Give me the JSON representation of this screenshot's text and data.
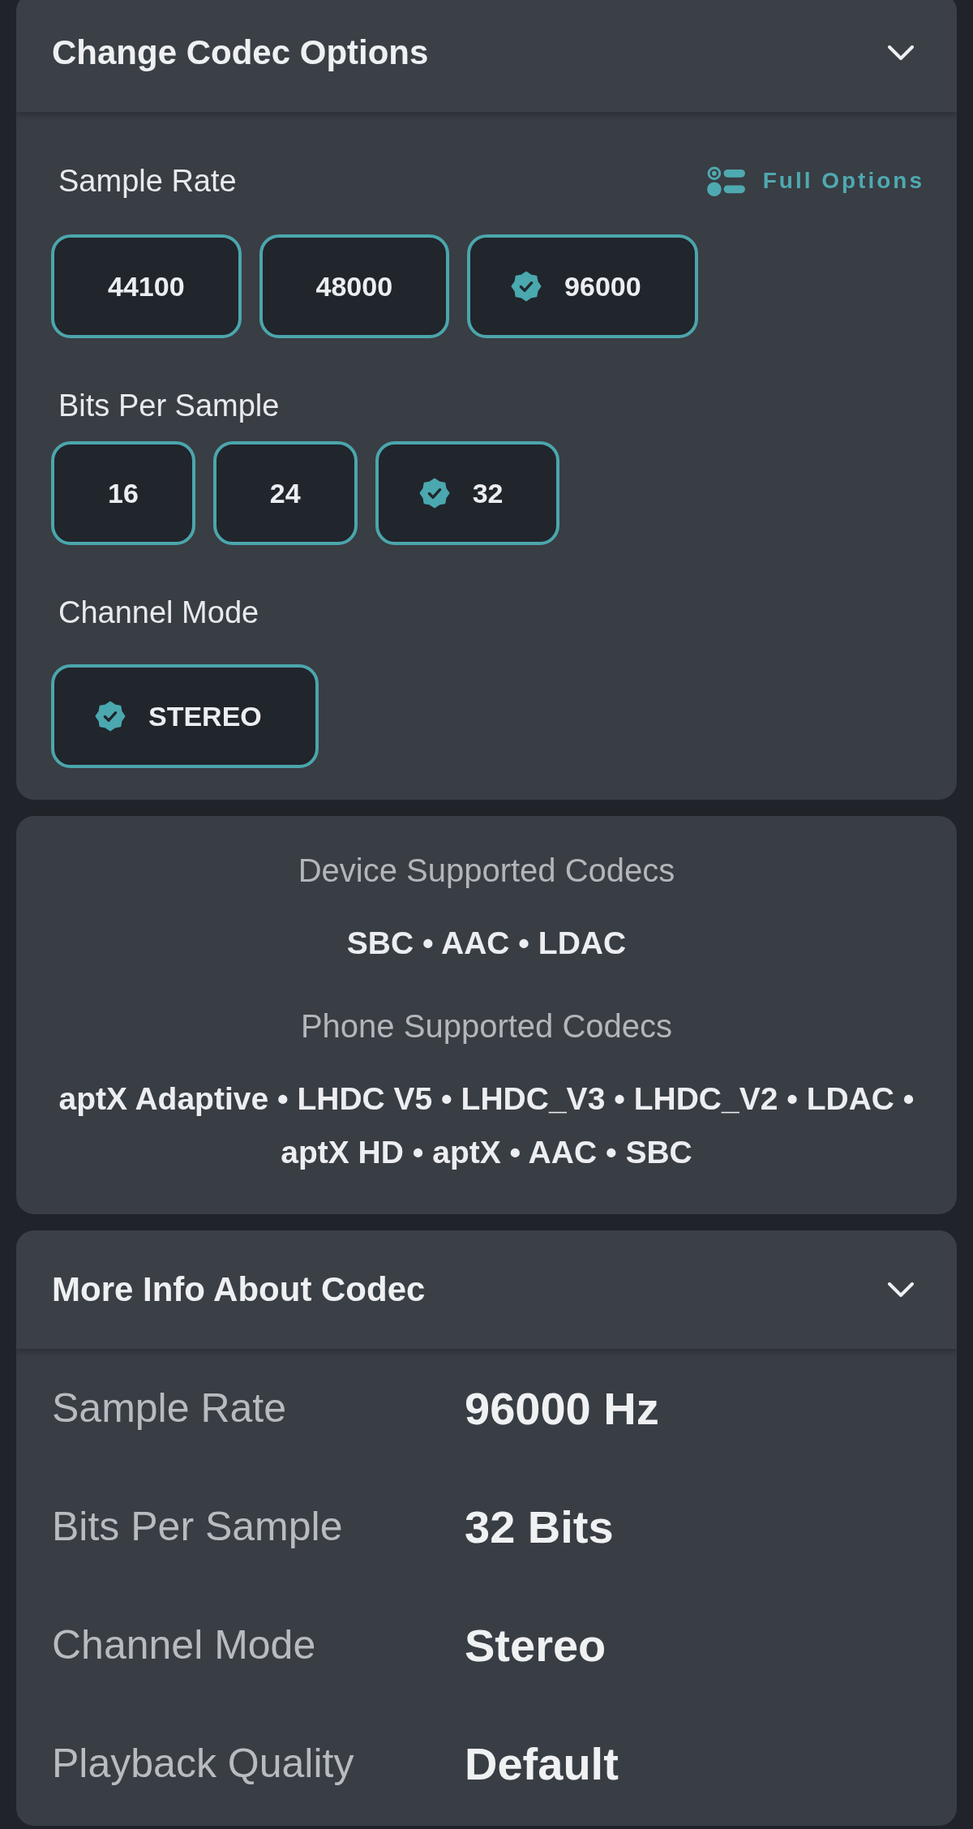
{
  "codec_options": {
    "title": "Change Codec Options",
    "groups": [
      {
        "label": "Sample Rate",
        "action": {
          "label": "Full Options"
        },
        "options": [
          {
            "label": "44100",
            "selected": false
          },
          {
            "label": "48000",
            "selected": false
          },
          {
            "label": "96000",
            "selected": true
          }
        ]
      },
      {
        "label": "Bits Per Sample",
        "options": [
          {
            "label": "16",
            "selected": false
          },
          {
            "label": "24",
            "selected": false
          },
          {
            "label": "32",
            "selected": true
          }
        ]
      },
      {
        "label": "Channel Mode",
        "options": [
          {
            "label": "STEREO",
            "selected": true
          }
        ]
      }
    ]
  },
  "supported_codecs": [
    {
      "heading": "Device Supported Codecs",
      "codecs": "SBC • AAC • LDAC"
    },
    {
      "heading": "Phone Supported Codecs",
      "codecs": "aptX Adaptive • LHDC V5 • LHDC_V3 • LHDC_V2 • LDAC • aptX HD • aptX • AAC • SBC"
    }
  ],
  "codec_info": {
    "title": "More Info About Codec",
    "rows": [
      {
        "label": "Sample Rate",
        "value": "96000 Hz"
      },
      {
        "label": "Bits Per Sample",
        "value": "32 Bits"
      },
      {
        "label": "Channel Mode",
        "value": "Stereo"
      },
      {
        "label": "Playback Quality",
        "value": "Default"
      }
    ]
  }
}
